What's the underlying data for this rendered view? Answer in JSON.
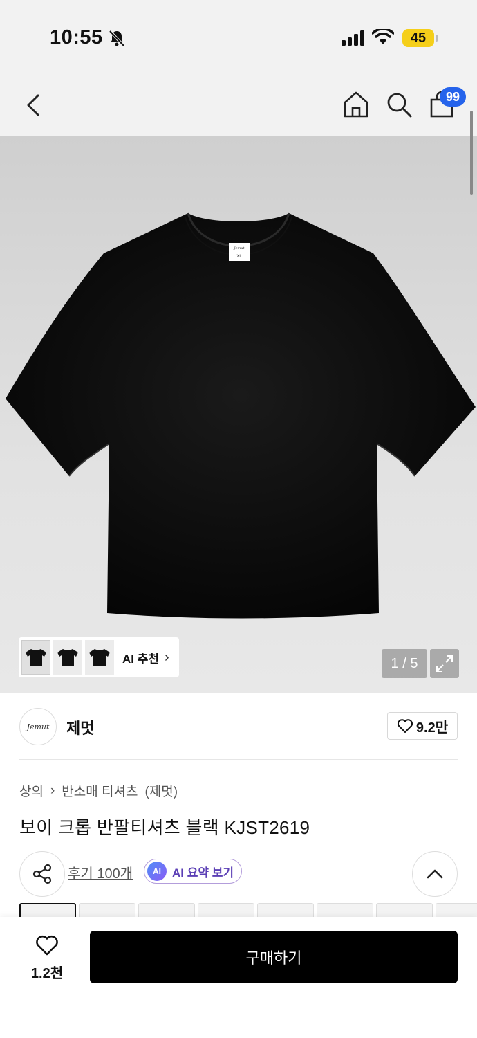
{
  "status_bar": {
    "time": "10:55",
    "battery": "45"
  },
  "nav": {
    "cart_count": "99"
  },
  "gallery": {
    "ai_recommend_label": "AI 추천",
    "page_counter": "1 / 5",
    "shirt_tag_brand": "Jemut",
    "shirt_tag_size": "XL"
  },
  "brand": {
    "logo_text": "Jemut",
    "name": "제멋",
    "likes": "9.2만"
  },
  "breadcrumb": {
    "category": "상의",
    "sub_category": "반소매 티셔츠",
    "brand": "(제멋)"
  },
  "product": {
    "title": "보이 크롭 반팔티셔츠 블랙 KJST2619"
  },
  "actions": {
    "reviews_label": "후기 100개",
    "ai_badge": "AI",
    "ai_summary_label": "AI 요약 보기"
  },
  "bottom_bar": {
    "wish_count": "1.2천",
    "buy_label": "구매하기"
  },
  "colors": {
    "accent_badge": "#2563eb",
    "battery": "#f5cf1a",
    "buy_button": "#000000"
  }
}
